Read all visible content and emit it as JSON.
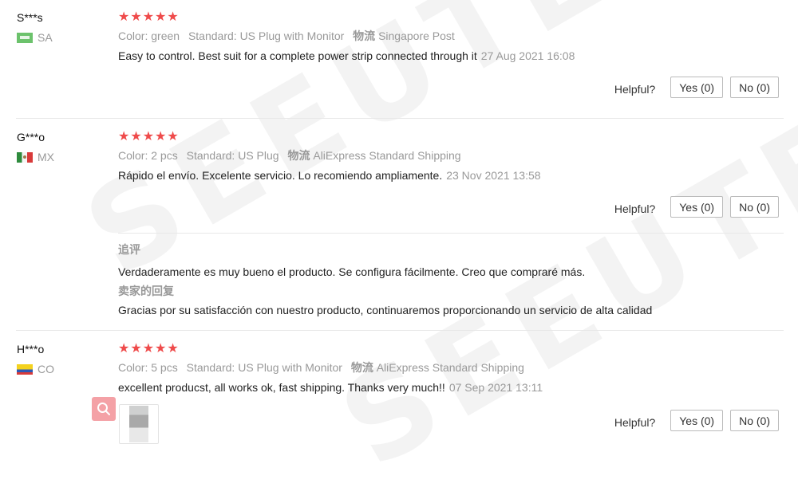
{
  "colors": {
    "star": "#ef4b4b",
    "muted": "#999999",
    "text": "#222222",
    "divider": "#e8e8e8"
  },
  "reviews": [
    {
      "name": "S***s",
      "country": "SA",
      "rating": 5,
      "meta": [
        {
          "key": "Color:",
          "value": "green"
        },
        {
          "key": "Standard:",
          "value": "US Plug with Monitor"
        },
        {
          "key": "物流",
          "value": "Singapore Post"
        }
      ],
      "text": "Easy to control. Best suit for a complete power strip connected through it",
      "time": "27 Aug 2021 16:08",
      "helpful": "Helpful?",
      "yes": "Yes (0)",
      "no": "No (0)"
    },
    {
      "name": "G***o",
      "country": "MX",
      "rating": 5,
      "meta": [
        {
          "key": "Color:",
          "value": "2 pcs"
        },
        {
          "key": "Standard:",
          "value": "US Plug"
        },
        {
          "key": "物流",
          "value": "AliExpress Standard Shipping"
        }
      ],
      "text": "Rápido el envío. Excelente servicio. Lo recomiendo ampliamente.",
      "time": "23 Nov 2021 13:58",
      "helpful": "Helpful?",
      "yes": "Yes (0)",
      "no": "No (0)",
      "followup": {
        "heading": "追评",
        "text": "Verdaderamente es muy bueno el producto. Se configura fácilmente. Creo que compraré más.",
        "seller_heading": "卖家的回复",
        "seller_text": "Gracias por su satisfacción con nuestro producto, continuaremos proporcionando un servicio de alta calidad"
      }
    },
    {
      "name": "H***o",
      "country": "CO",
      "rating": 5,
      "meta": [
        {
          "key": "Color:",
          "value": "5 pcs"
        },
        {
          "key": "Standard:",
          "value": "US Plug with Monitor"
        },
        {
          "key": "物流",
          "value": "AliExpress Standard Shipping"
        }
      ],
      "text": "excellent producst, all works ok, fast shipping. Thanks very much!!",
      "time": "07 Sep 2021 13:11",
      "helpful": "Helpful?",
      "yes": "Yes (0)",
      "no": "No (0)"
    }
  ]
}
